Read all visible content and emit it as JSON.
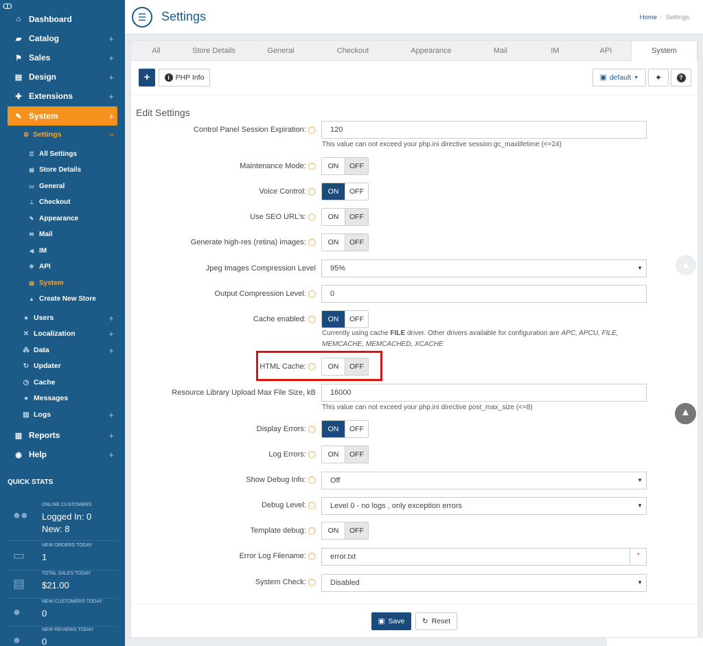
{
  "sidebar": {
    "nav": [
      {
        "label": "Dashboard",
        "icon": "home-icon",
        "glyph": "⌂",
        "plus": ""
      },
      {
        "label": "Catalog",
        "icon": "folder-icon",
        "glyph": "▰",
        "plus": "+"
      },
      {
        "label": "Sales",
        "icon": "flag-icon",
        "glyph": "⚑",
        "plus": "+"
      },
      {
        "label": "Design",
        "icon": "file-icon",
        "glyph": "▤",
        "plus": "+"
      },
      {
        "label": "Extensions",
        "icon": "puzzle-icon",
        "glyph": "✚",
        "plus": "+"
      },
      {
        "label": "System",
        "icon": "wrench-icon",
        "glyph": "✎",
        "plus": "+"
      }
    ],
    "settings": {
      "label": "Settings",
      "glyph": "⚙",
      "minus": "–"
    },
    "settings_children": [
      {
        "label": "All Settings",
        "glyph": "☰"
      },
      {
        "label": "Store Details",
        "glyph": "▤"
      },
      {
        "label": "General",
        "glyph": "▭"
      },
      {
        "label": "Checkout",
        "glyph": "⊥"
      },
      {
        "label": "Appearance",
        "glyph": "✎"
      },
      {
        "label": "Mail",
        "glyph": "✉"
      },
      {
        "label": "IM",
        "glyph": "◀"
      },
      {
        "label": "API",
        "glyph": "✻"
      },
      {
        "label": "System",
        "glyph": "▤"
      },
      {
        "label": "Create New Store",
        "glyph": "▲"
      }
    ],
    "system_children": [
      {
        "label": "Users",
        "glyph": "●",
        "plus": "+"
      },
      {
        "label": "Localization",
        "glyph": "✕",
        "plus": "+"
      },
      {
        "label": "Data",
        "glyph": "⁂",
        "plus": "+"
      },
      {
        "label": "Updater",
        "glyph": "↻",
        "plus": ""
      },
      {
        "label": "Cache",
        "glyph": "◷",
        "plus": ""
      },
      {
        "label": "Messages",
        "glyph": "●",
        "plus": ""
      },
      {
        "label": "Logs",
        "glyph": "▤",
        "plus": "+"
      }
    ],
    "bottom_nav": [
      {
        "label": "Reports",
        "icon": "bar-chart-icon",
        "glyph": "▥",
        "plus": "+"
      },
      {
        "label": "Help",
        "icon": "globe-icon",
        "glyph": "◉",
        "plus": "+"
      }
    ],
    "quick_stats_title": "QUICK STATS",
    "stats": {
      "online": {
        "label": "ONLINE CUSTOMERS",
        "line1": "Logged In: 0",
        "line2": "New: 8"
      },
      "orders": {
        "label": "NEW ORDERS TODAY",
        "value": "1"
      },
      "sales": {
        "label": "TOTAL SALES TODAY",
        "value": "$21.00"
      },
      "customers": {
        "label": "NEW CUSTOMERS TODAY",
        "value": "0"
      },
      "reviews": {
        "label": "NEW REVIEWS TODAY",
        "value": "0"
      }
    }
  },
  "header": {
    "title": "Settings",
    "breadcrumb_home": "Home",
    "breadcrumb_sep": "/",
    "breadcrumb_current": "Settings"
  },
  "tabs": [
    "All",
    "Store Details",
    "General",
    "Checkout",
    "Appearance",
    "Mail",
    "IM",
    "API",
    "System"
  ],
  "toolbar": {
    "add_label": "+",
    "phpinfo_label": "PHP Info",
    "default_label": "default"
  },
  "form": {
    "title": "Edit Settings",
    "session_expiration": {
      "label": "Control Panel Session Expiration:",
      "value": "120",
      "help": "This value can not exceed your php.ini directive session.gc_maxlifetime (<=24)"
    },
    "maintenance_mode": {
      "label": "Maintenance Mode:",
      "state": "off"
    },
    "voice_control": {
      "label": "Voice Control:",
      "state": "on"
    },
    "seo_urls": {
      "label": "Use SEO URL's:",
      "state": "off"
    },
    "retina_images": {
      "label": "Generate high-res (retina) images:",
      "state": "off"
    },
    "jpeg_compression": {
      "label": "Jpeg Images Compression Level",
      "value": "95%"
    },
    "output_compression": {
      "label": "Output Compression Level:",
      "value": "0"
    },
    "cache_enabled": {
      "label": "Cache enabled:",
      "state": "on",
      "help_pre": "Currently using cache ",
      "help_bold": "FILE",
      "help_mid": " driver. Other drivers available for configuration are ",
      "help_drivers": "APC, APCU, FILE, MEMCACHE, MEMCACHED, XCACHE"
    },
    "html_cache": {
      "label": "HTML Cache:",
      "state": "off"
    },
    "upload_max": {
      "label": "Resource Library Upload Max File Size, kB",
      "value": "16000",
      "help": "This value can not exceed your php.ini directive post_max_size (<=8)"
    },
    "display_errors": {
      "label": "Display Errors:",
      "state": "on"
    },
    "log_errors": {
      "label": "Log Errors:",
      "state": "off"
    },
    "show_debug": {
      "label": "Show Debug Info:",
      "value": "Off"
    },
    "debug_level": {
      "label": "Debug Level:",
      "value": "Level 0 - no logs , only exception errors"
    },
    "template_debug": {
      "label": "Template debug:",
      "state": "off"
    },
    "error_log": {
      "label": "Error Log Filename:",
      "value": "error.txt",
      "required": "*"
    },
    "system_check": {
      "label": "System Check:",
      "value": "Disabled"
    },
    "on_label": "ON",
    "off_label": "OFF"
  },
  "actions": {
    "save_label": "Save",
    "reset_label": "Reset"
  },
  "colors": {
    "sidebar": "#1c5a88",
    "accent": "#f5921e",
    "primary_button": "#1c4a7a",
    "highlight": "#e01010"
  }
}
